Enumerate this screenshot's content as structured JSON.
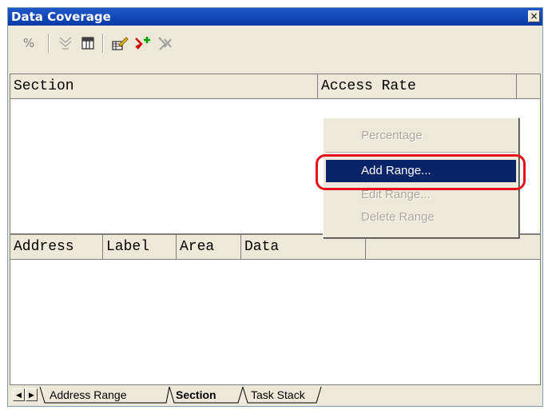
{
  "window": {
    "title": "Data Coverage",
    "close_glyph": "×"
  },
  "toolbar": {
    "percent_label": "%",
    "buttons": [
      "percent-icon",
      "range-icon",
      "table-icon",
      "edit-icon",
      "add-icon",
      "delete-icon"
    ]
  },
  "section_table": {
    "columns": [
      "Section",
      "Access Rate"
    ]
  },
  "detail_table": {
    "columns": [
      "Address",
      "Label",
      "Area",
      "Data"
    ]
  },
  "tabs": {
    "items": [
      "Address Range",
      "Section",
      "Task Stack"
    ],
    "active": "Section"
  },
  "context_menu": {
    "items": [
      {
        "label": "Percentage",
        "state": "disabled"
      },
      {
        "label": "Add Range...",
        "state": "active"
      },
      {
        "label": "Edit Range...",
        "state": "disabled"
      },
      {
        "label": "Delete Range",
        "state": "disabled"
      }
    ]
  },
  "colors": {
    "title_bar": "#0a3aa8",
    "menu_highlight": "#0a246a",
    "annotation": "#e8101a"
  }
}
